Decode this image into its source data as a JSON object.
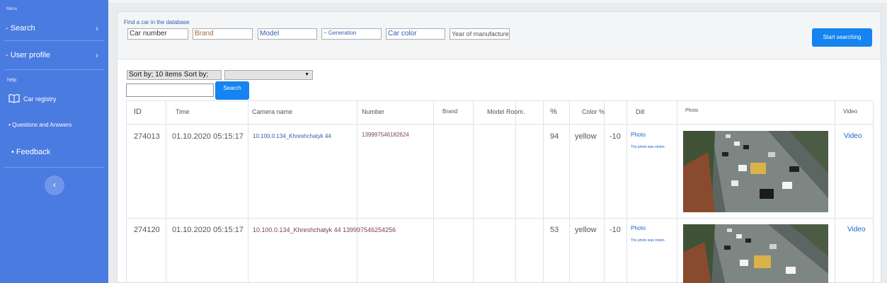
{
  "sidebar": {
    "menu_label": "Menu",
    "items": [
      {
        "label": "- Search",
        "chevron": "›"
      },
      {
        "label": "- User profile",
        "chevron": "›"
      }
    ],
    "help_label": "help",
    "registry_label": "Car registry",
    "qa_label": "• Questions and Answers",
    "feedback_label": "• Feedback",
    "collapse_icon": "‹"
  },
  "search_panel": {
    "title": "Find a car in the database",
    "fields": {
      "car_number": "Car number",
      "brand": "Brand",
      "model": "Model",
      "generation": "~ Generation",
      "car_color": "Car color",
      "year": "Year of manufacture"
    },
    "start_button": "Start searching"
  },
  "toolbar": {
    "sort_label": "Sort by; 10 items Sort by;",
    "search_button": "Search"
  },
  "table": {
    "headers": {
      "id": "ID",
      "time": "Time",
      "camera": "Camera name",
      "number": "Number",
      "brand": "Brand",
      "model": "Model Room.",
      "percent": "%",
      "color": "Color %",
      "dill": "Dill",
      "photo": "Photo",
      "video": "Video"
    },
    "rows": [
      {
        "id": "274013",
        "time": "01.10.2020 05:15:17",
        "camera": "10.100.0.134_Khreshchatyk 44",
        "number": "139997546182624",
        "percent": "94",
        "color": "yellow",
        "color_pct": "-10",
        "photo_link": "Photo",
        "stolen_note": "The photo was stolen.",
        "video_link": "Video"
      },
      {
        "id": "274120",
        "time": "01.10.2020 05:15:17",
        "camera": "10.100.0.134_Khreshchatyk 44 139997546254256",
        "number": "",
        "percent": "53",
        "color": "yellow",
        "color_pct": "-10",
        "photo_link": "Photo",
        "stolen_note": "The photo was stolen.",
        "video_link": "Video"
      }
    ]
  },
  "colors": {
    "sidebar_bg": "#4a7be0",
    "accent": "#1583f0",
    "link": "#1a63c8"
  }
}
